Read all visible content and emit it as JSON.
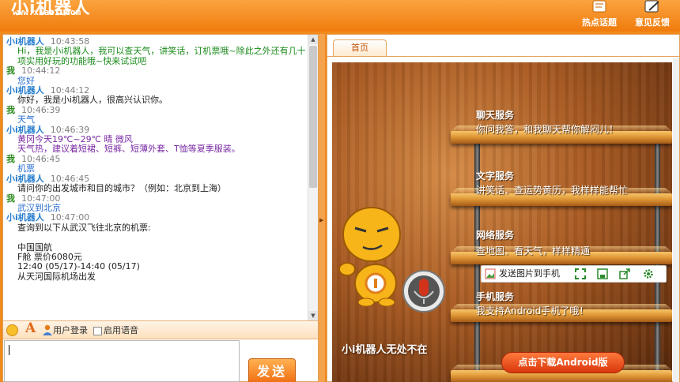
{
  "header": {
    "logo_text": "小i机器人",
    "logo_url": "www.xiaoi.com",
    "hot_topics_label": "热点话题",
    "feedback_label": "意见反馈"
  },
  "chat": {
    "messages": [
      {
        "sender": "小i机器人",
        "is_bot": true,
        "time": "10:43:58",
        "color": "green",
        "text": "Hi，我是小i机器人，我可以查天气，讲笑话，订机票哦~除此之外还有几十项实用好玩的功能哦~快来试试吧"
      },
      {
        "sender": "我",
        "is_bot": false,
        "time": "10:44:12",
        "color": "blue",
        "text": "您好"
      },
      {
        "sender": "小i机器人",
        "is_bot": true,
        "time": "10:44:12",
        "color": "black",
        "text": "你好，我是小i机器人，很高兴认识你。"
      },
      {
        "sender": "我",
        "is_bot": false,
        "time": "10:46:39",
        "color": "blue",
        "text": "天气"
      },
      {
        "sender": "小i机器人",
        "is_bot": true,
        "time": "10:46:39",
        "color": "purple",
        "text": "黄冈今天19℃~29℃ 晴 微风\n天气热，建议着短裙、短裤、短薄外套、T恤等夏季服装。"
      },
      {
        "sender": "我",
        "is_bot": false,
        "time": "10:46:45",
        "color": "blue",
        "text": "机票"
      },
      {
        "sender": "小i机器人",
        "is_bot": true,
        "time": "10:46:45",
        "color": "black",
        "text": "请问你的出发城市和目的城市？（例如：北京到上海）"
      },
      {
        "sender": "我",
        "is_bot": false,
        "time": "10:47:00",
        "color": "blue",
        "text": "武汉到北京"
      },
      {
        "sender": "小i机器人",
        "is_bot": true,
        "time": "10:47:00",
        "color": "black",
        "text": "查询到以下从武汉飞往北京的机票:\n\n中国国航\nF舱 票价6080元\n12:40 (05/17)-14:40 (05/17)\n从天河国际机场出发"
      }
    ],
    "toolbar": {
      "font_label": "A",
      "login_label": "用户登录",
      "voice_label": "启用语音"
    },
    "send_label": "发送"
  },
  "right": {
    "tab_home": "首页",
    "services": [
      {
        "title": "聊天服务",
        "desc": "你问我答，和我聊天帮你解闷儿！"
      },
      {
        "title": "文字服务",
        "desc": "讲笑话、查运势黄历，我样样能帮忙"
      },
      {
        "title": "网络服务",
        "desc": "查地图、看天气，样样精通"
      },
      {
        "title": "手机服务",
        "desc": "我支持Android手机了哦！"
      }
    ],
    "send_pic_label": "发送图片到手机",
    "tagline": "小i机器人无处不在",
    "android_button": "点击下载Android版"
  },
  "colors": {
    "brand_orange": "#f08a1c",
    "bot_name": "#2a7fcf",
    "user_name": "#2d8a1f"
  }
}
